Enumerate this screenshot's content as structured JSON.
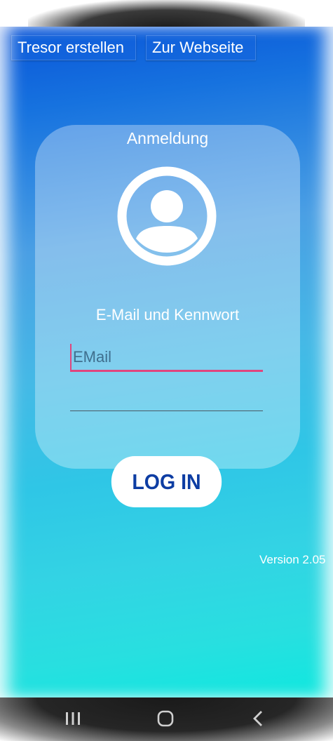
{
  "toolbar": {
    "create_vault_label": "Tresor erstellen",
    "website_label": "Zur Webseite"
  },
  "login_card": {
    "title": "Anmeldung",
    "avatar_icon": "account-circle-icon",
    "subtitle": "E-Mail und Kennwort",
    "email": {
      "value": "",
      "placeholder": "EMail"
    },
    "password": {
      "value": "",
      "placeholder": ""
    }
  },
  "login_button_label": "LOG IN",
  "version_text": "Version 2.05",
  "navbar": {
    "recent_icon": "recent-apps-icon",
    "home_icon": "home-icon",
    "back_icon": "back-icon"
  },
  "colors": {
    "gradient_top": "#0a55d8",
    "gradient_bottom": "#0fe8df",
    "login_text": "#0d3da3",
    "input_focus": "#e0457d"
  }
}
